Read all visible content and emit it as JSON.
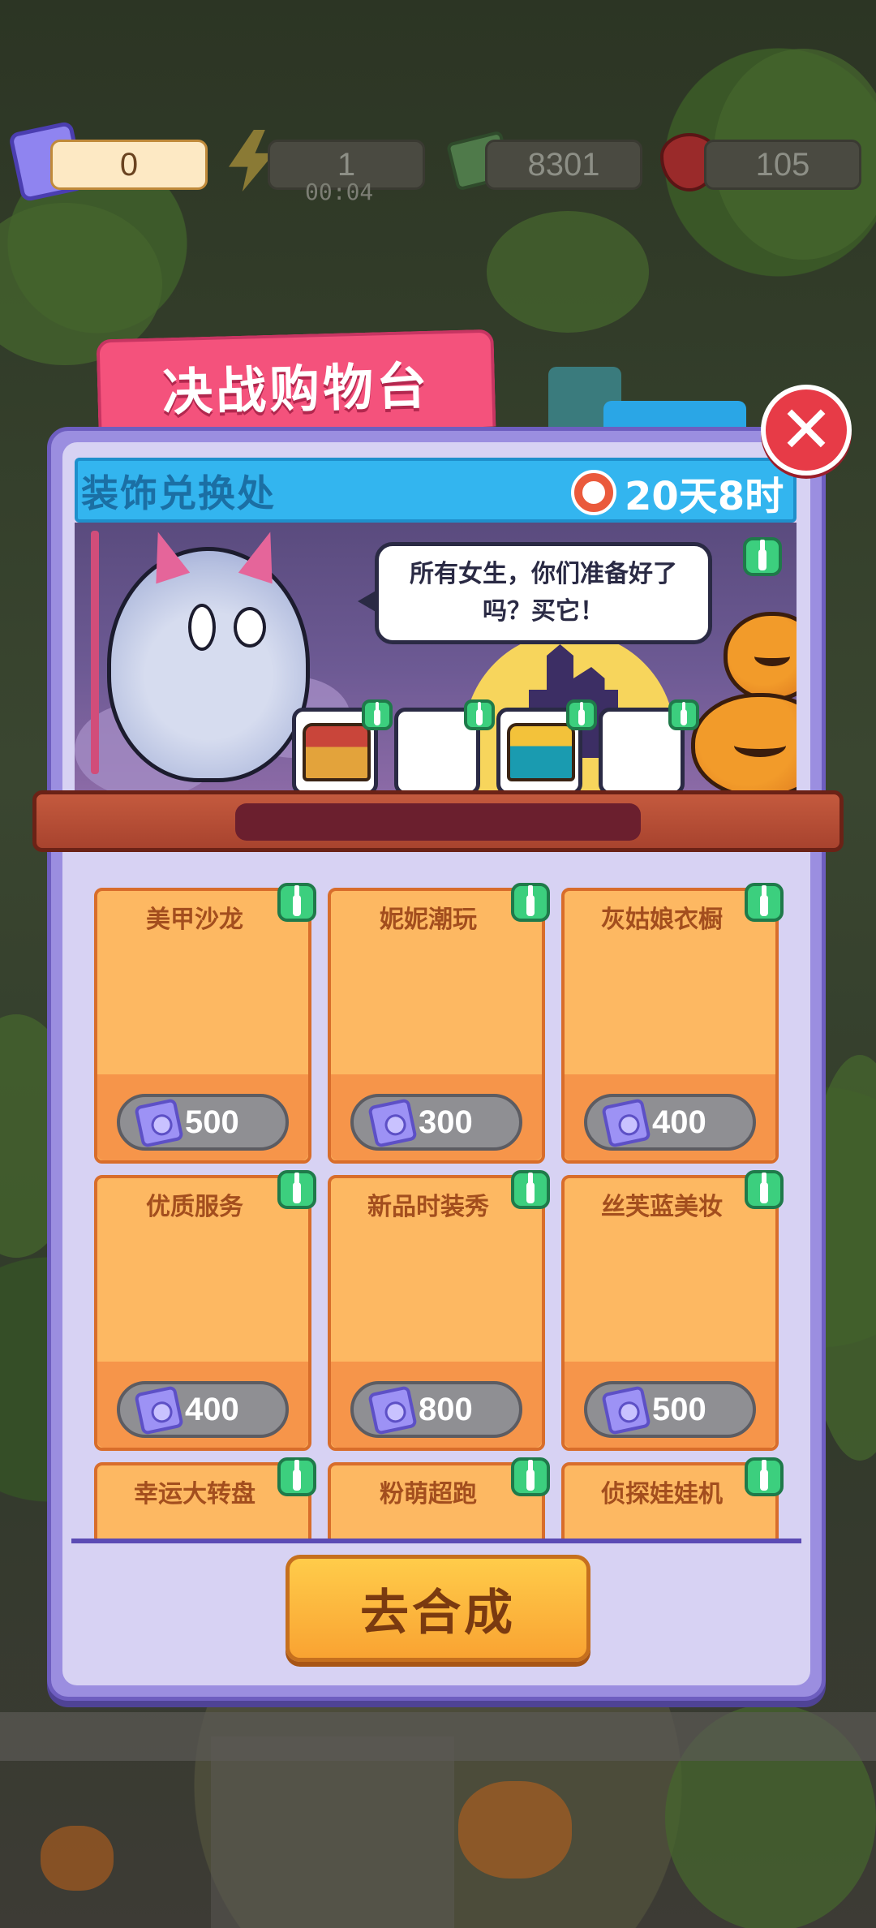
{
  "hud": {
    "tickets": "0",
    "energy": "1",
    "energy_timer": "00:04",
    "cash": "8301",
    "gems": "105"
  },
  "dialog": {
    "banner_title": "决战购物台",
    "header_title": "装饰兑换处",
    "countdown": "20天8时",
    "speech": "所有女生，你们准备好了吗？买它！",
    "go_button": "去合成"
  },
  "items": [
    {
      "name": "美甲沙龙",
      "price": "500"
    },
    {
      "name": "妮妮潮玩",
      "price": "300"
    },
    {
      "name": "灰姑娘衣橱",
      "price": "400"
    },
    {
      "name": "优质服务",
      "price": "400"
    },
    {
      "name": "新品时装秀",
      "price": "800"
    },
    {
      "name": "丝芙蓝美妆",
      "price": "500"
    },
    {
      "name": "幸运大转盘",
      "price": ""
    },
    {
      "name": "粉萌超跑",
      "price": ""
    },
    {
      "name": "侦探娃娃机",
      "price": ""
    }
  ],
  "colors": {
    "banner": "#f4527c",
    "header": "#33b5ef",
    "card": "#fdb862",
    "button": "#f9a332",
    "close": "#e73b47"
  }
}
